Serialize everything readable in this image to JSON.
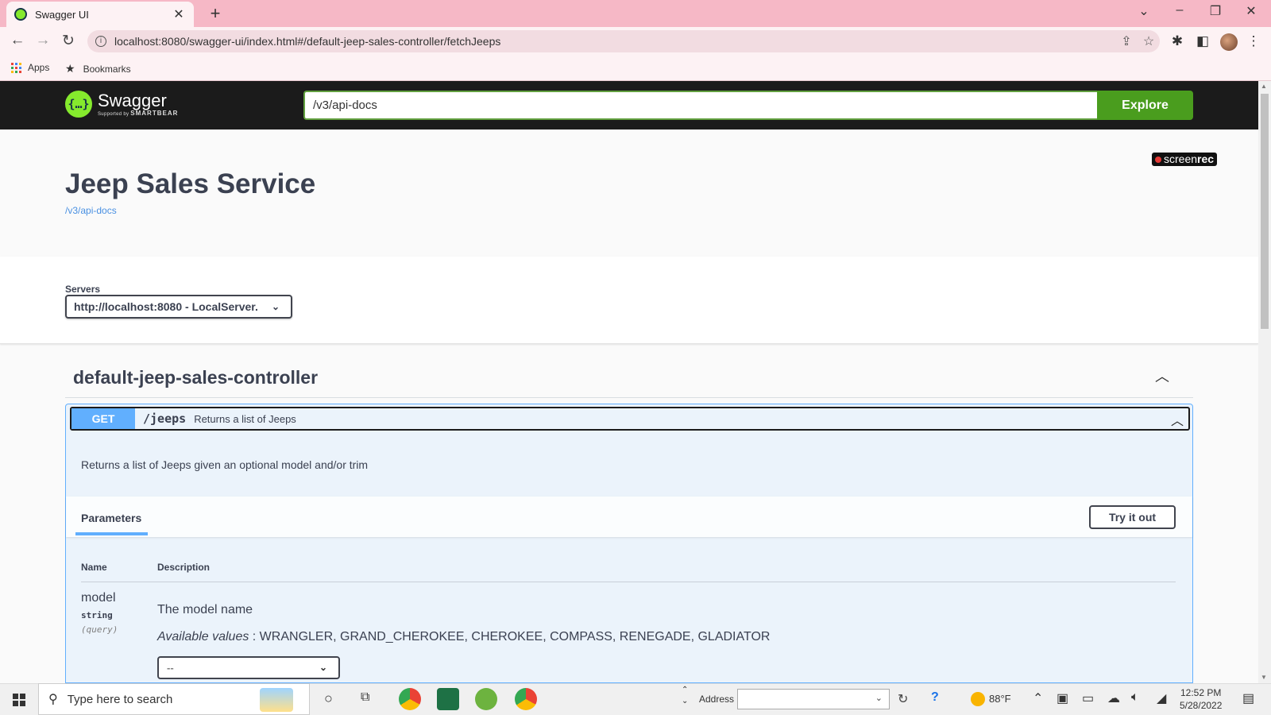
{
  "browser": {
    "tab_title": "Swagger UI",
    "url": "localhost:8080/swagger-ui/index.html#/default-jeep-sales-controller/fetchJeeps",
    "bookmarks": [
      "Apps",
      "Bookmarks"
    ]
  },
  "topbar": {
    "brand": "Swagger",
    "brand_sub": "Supported by",
    "brand_company": "SMARTBEAR",
    "spec_url": "/v3/api-docs",
    "explore_label": "Explore"
  },
  "overlay": {
    "screenrec_a": "screen",
    "screenrec_b": "rec"
  },
  "info": {
    "title": "Jeep Sales Service",
    "link": "/v3/api-docs"
  },
  "servers": {
    "label": "Servers",
    "selected": "http://localhost:8080 - LocalServer."
  },
  "tag": {
    "name": "default-jeep-sales-controller"
  },
  "operation": {
    "method": "GET",
    "path": "/jeeps",
    "summary": "Returns a list of Jeeps",
    "description": "Returns a list of Jeeps given an optional model and/or trim",
    "parameters_tab": "Parameters",
    "try_it_out": "Try it out",
    "col_name": "Name",
    "col_description": "Description",
    "params": [
      {
        "name": "model",
        "type": "string",
        "in": "(query)",
        "description": "The model name",
        "available_label": "Available values",
        "available_values": " : WRANGLER, GRAND_CHEROKEE, CHEROKEE, COMPASS, RENEGADE, GLADIATOR",
        "selected": "--"
      }
    ]
  },
  "taskbar": {
    "search_placeholder": "Type here to search",
    "address_label": "Address",
    "temperature": "88°F",
    "time": "12:52 PM",
    "date": "5/28/2022"
  },
  "colors": {
    "get_method": "#61affe",
    "swagger_green": "#85ea2d",
    "explore_button": "#4a9d1e",
    "browser_chrome": "#f6b8c6"
  }
}
